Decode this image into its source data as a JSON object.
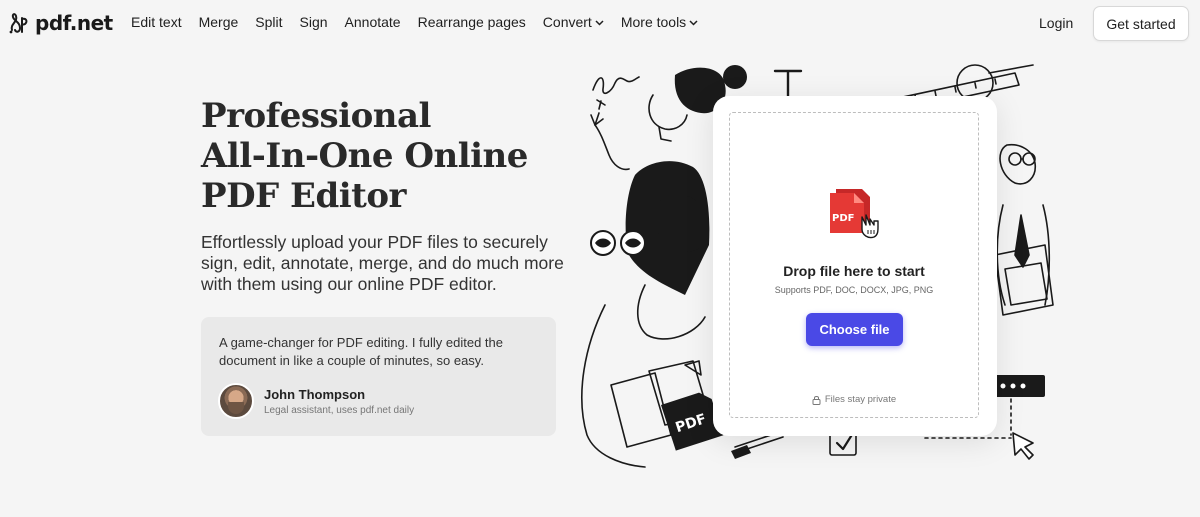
{
  "brand": {
    "name": "pdf.net"
  },
  "nav": {
    "items": [
      {
        "label": "Edit text",
        "dropdown": false
      },
      {
        "label": "Merge",
        "dropdown": false
      },
      {
        "label": "Split",
        "dropdown": false
      },
      {
        "label": "Sign",
        "dropdown": false
      },
      {
        "label": "Annotate",
        "dropdown": false
      },
      {
        "label": "Rearrange pages",
        "dropdown": false
      },
      {
        "label": "Convert",
        "dropdown": true
      },
      {
        "label": "More tools",
        "dropdown": true
      }
    ],
    "login": "Login",
    "get_started": "Get started"
  },
  "hero": {
    "title_lines": [
      "Professional",
      "All-In-One Online",
      "PDF Editor"
    ],
    "subtitle": "Effortlessly upload your PDF files to securely sign, edit, annotate, merge, and do much more with them using our online PDF editor."
  },
  "testimonial": {
    "quote": "A game-changer for PDF editing. I fully edited the document in like a couple of minutes, so easy.",
    "name": "John Thompson",
    "role": "Legal assistant, uses pdf.net daily"
  },
  "upload": {
    "icon_label": "PDF",
    "title": "Drop file here to start",
    "formats": "Supports PDF, DOC, DOCX, JPG, PNG",
    "button": "Choose file",
    "privacy": "Files stay private"
  },
  "illustration": {
    "doc_label": "PDF",
    "letter": "T"
  },
  "colors": {
    "accent": "#4a49e6",
    "pdf_red": "#e53935",
    "background": "#f5f5f5"
  }
}
